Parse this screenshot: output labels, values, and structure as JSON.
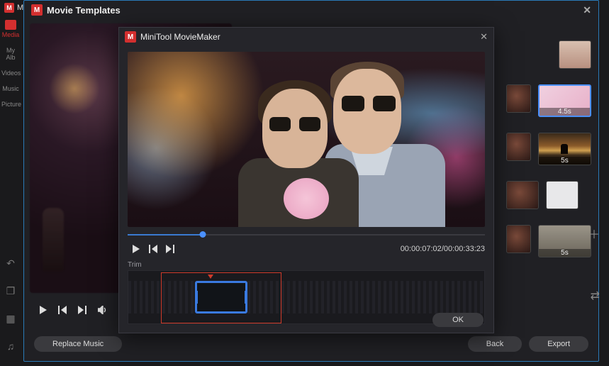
{
  "app": {
    "title_short": "Mi",
    "title_full": "MiniTool"
  },
  "sidebar": {
    "items": [
      {
        "label": "Media"
      },
      {
        "label": "My Alb"
      },
      {
        "label": "Videos"
      },
      {
        "label": "Music"
      },
      {
        "label": "Picture"
      }
    ]
  },
  "templates": {
    "title": "Movie Templates",
    "preview_controls": {
      "play": "▶",
      "prev": "◁|",
      "next": "|▷",
      "vol": "🔊"
    },
    "thumbs": [
      {
        "duration": "4.5s"
      },
      {
        "duration": "5s"
      },
      {
        "duration": ""
      },
      {
        "duration": ""
      },
      {
        "duration": "5s"
      },
      {
        "duration": ""
      }
    ],
    "footer": {
      "replace_music": "Replace Music",
      "back": "Back",
      "export": "Export"
    }
  },
  "moviemaker": {
    "title": "MiniTool MovieMaker",
    "time_current": "00:00:07:02",
    "time_total": "00:00:33:23",
    "trim_label": "Trim",
    "ok": "OK",
    "progress_pct": 21
  }
}
